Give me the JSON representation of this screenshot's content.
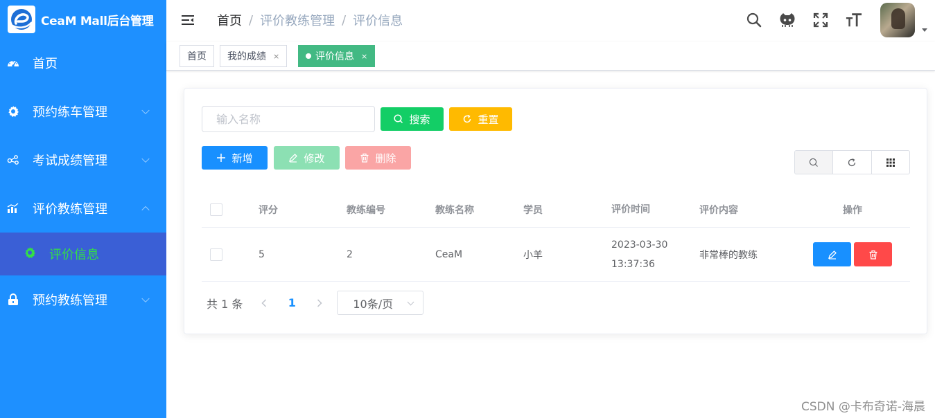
{
  "app": {
    "title": "CeaM Mall后台管理"
  },
  "sidebar": {
    "items": [
      {
        "label": "首页",
        "icon": "dashboard-icon"
      },
      {
        "label": "预约练车管理",
        "icon": "gear-icon"
      },
      {
        "label": "考试成绩管理",
        "icon": "share-nodes-icon"
      },
      {
        "label": "评价教练管理",
        "icon": "bar-chart-icon"
      },
      {
        "label": "预约教练管理",
        "icon": "lock-icon"
      }
    ],
    "sub_item": {
      "label": "评价信息",
      "icon": "gear-icon",
      "color": "#33e045"
    },
    "background": "#1e90ff"
  },
  "breadcrumb": {
    "home": "首页",
    "sep": "/",
    "level1": "评价教练管理",
    "level2": "评价信息"
  },
  "tags": [
    {
      "label": "首页"
    },
    {
      "label": "我的成绩",
      "close": "×"
    },
    {
      "label": "评价信息",
      "close": "×"
    }
  ],
  "search": {
    "placeholder": "输入名称",
    "search_label": "搜索",
    "reset_label": "重置"
  },
  "toolbar": {
    "add_label": "新增",
    "edit_label": "修改",
    "delete_label": "删除"
  },
  "table": {
    "headers": [
      "评分",
      "教练编号",
      "教练名称",
      "学员",
      "评价时间",
      "评价内容",
      "操作"
    ],
    "rows": [
      {
        "score": "5",
        "coach_no": "2",
        "coach_name": "CeaM",
        "student": "小羊",
        "time": "2023-03-30 13:37:36",
        "content": "非常棒的教练"
      }
    ]
  },
  "pagination": {
    "total": "共 1 条",
    "current": "1",
    "page_size": "10条/页"
  },
  "watermark": "CSDN @卡布奇诺-海晨",
  "colors": {
    "primary": "#1890ff",
    "success": "#13ce66",
    "warning": "#ffba00",
    "danger": "#ff4949",
    "tag_active": "#42b983"
  }
}
